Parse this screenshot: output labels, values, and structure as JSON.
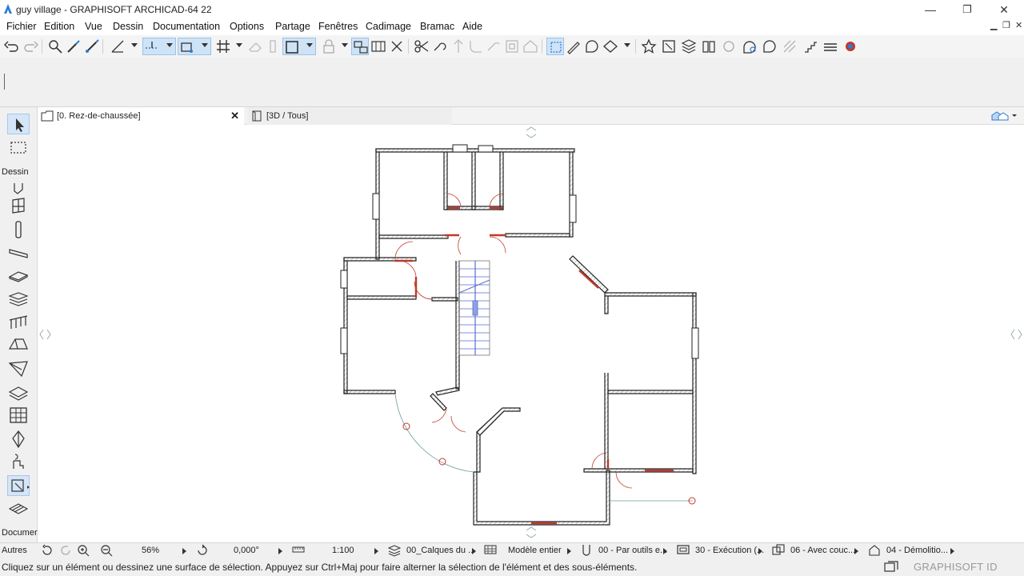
{
  "window": {
    "title": "guy village - GRAPHISOFT ARCHICAD-64 22",
    "minimize": "—",
    "restore": "❐",
    "close": "✕"
  },
  "menu": {
    "items": [
      "Fichier",
      "Edition",
      "Vue",
      "Dessin",
      "Documentation",
      "Options",
      "Partage",
      "Fenêtres",
      "Cadimage",
      "Bramac",
      "Aide"
    ]
  },
  "toolbox": {
    "dessin_label": "Dessin",
    "documer_label": "Documer",
    "autres_label": "Autres"
  },
  "tabs": {
    "plan_label": "[0. Rez-de-chaussée]",
    "close": "✕",
    "view3d_label": "[3D / Tous]"
  },
  "navbar": {
    "zoom": "56%",
    "angle": "0,000°",
    "scale": "1:100",
    "layers": "00_Calques du ...",
    "model": "Modèle entier",
    "pens": "00 - Par outils e...",
    "mvo": "30 - Exécution (...",
    "override": "06 - Avec couc...",
    "renovation": "04 - Démolitio..."
  },
  "status": {
    "message": "Cliquez sur un élément ou dessinez une surface de sélection. Appuyez sur Ctrl+Maj pour faire alterner la sélection de l'élément et des sous-éléments.",
    "brand": "GRAPHISOFT ID"
  },
  "colors": {
    "accent": "#2f7bd6",
    "wall": "#222222",
    "opening": "#c0392b",
    "stair": "#5a6fd0"
  }
}
